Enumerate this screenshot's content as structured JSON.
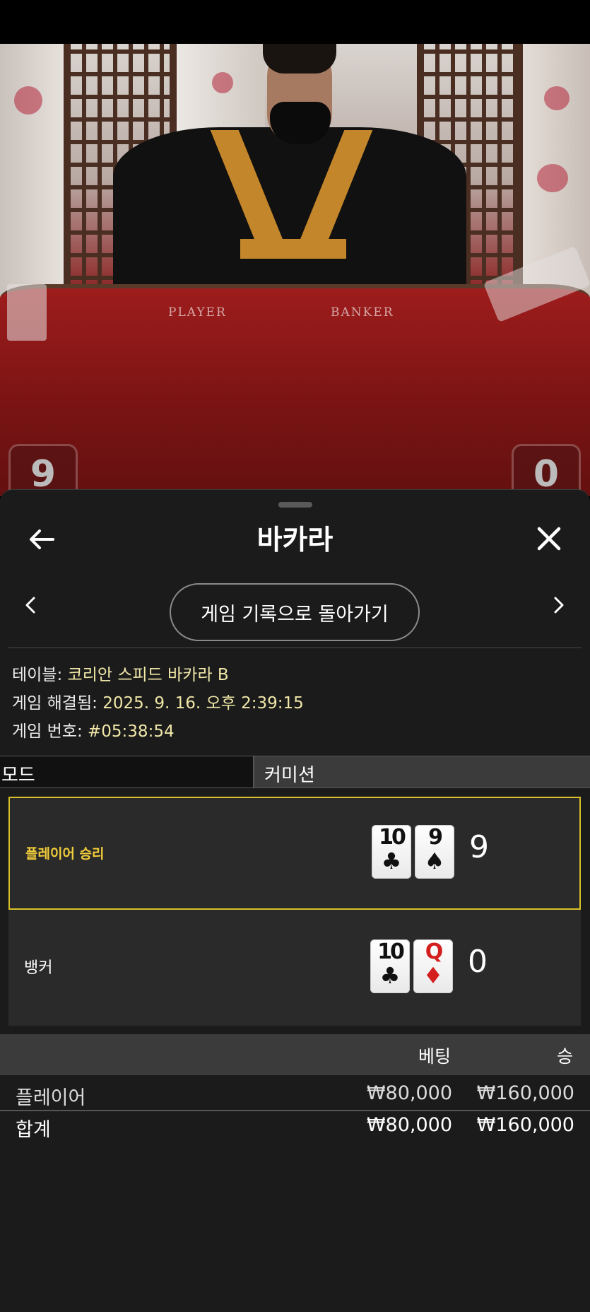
{
  "video": {
    "table_labels": {
      "player": "PLAYER",
      "banker": "BANKER"
    },
    "score_tabs": {
      "left": "9",
      "right": "0"
    }
  },
  "sheet": {
    "title": "바카라",
    "history_button": "게임 기록으로 돌아가기"
  },
  "info": {
    "table_label": "테이블:",
    "table_value": "코리안 스피드 바카라 B",
    "resolved_label": "게임 해결됨:",
    "resolved_value": "2025. 9. 16. 오후 2:39:15",
    "game_no_label": "게임 번호:",
    "game_no_value": "#05:38:54"
  },
  "mode_row": {
    "mode": "모드",
    "commission": "커미션"
  },
  "results": {
    "player": {
      "label": "플레이어 승리",
      "cards": [
        {
          "rank": "10",
          "suit": "♣"
        },
        {
          "rank": "9",
          "suit": "♠"
        }
      ],
      "score": "9"
    },
    "banker": {
      "label": "뱅커",
      "cards": [
        {
          "rank": "10",
          "suit": "♣"
        },
        {
          "rank": "Q",
          "suit": "♦"
        }
      ],
      "score": "0"
    }
  },
  "bets": {
    "headers": {
      "bet": "베팅",
      "win": "승"
    },
    "rows": [
      {
        "name": "플레이어",
        "bet": "₩80,000",
        "win": "₩160,000"
      }
    ],
    "total": {
      "name": "합계",
      "bet": "₩80,000",
      "win": "₩160,000"
    }
  },
  "colors": {
    "sheet_bg": "#1b1b1b",
    "winner_border": "#d8c02a",
    "winner_label": "#f2cd3a",
    "info_value": "#f0e7a8"
  }
}
